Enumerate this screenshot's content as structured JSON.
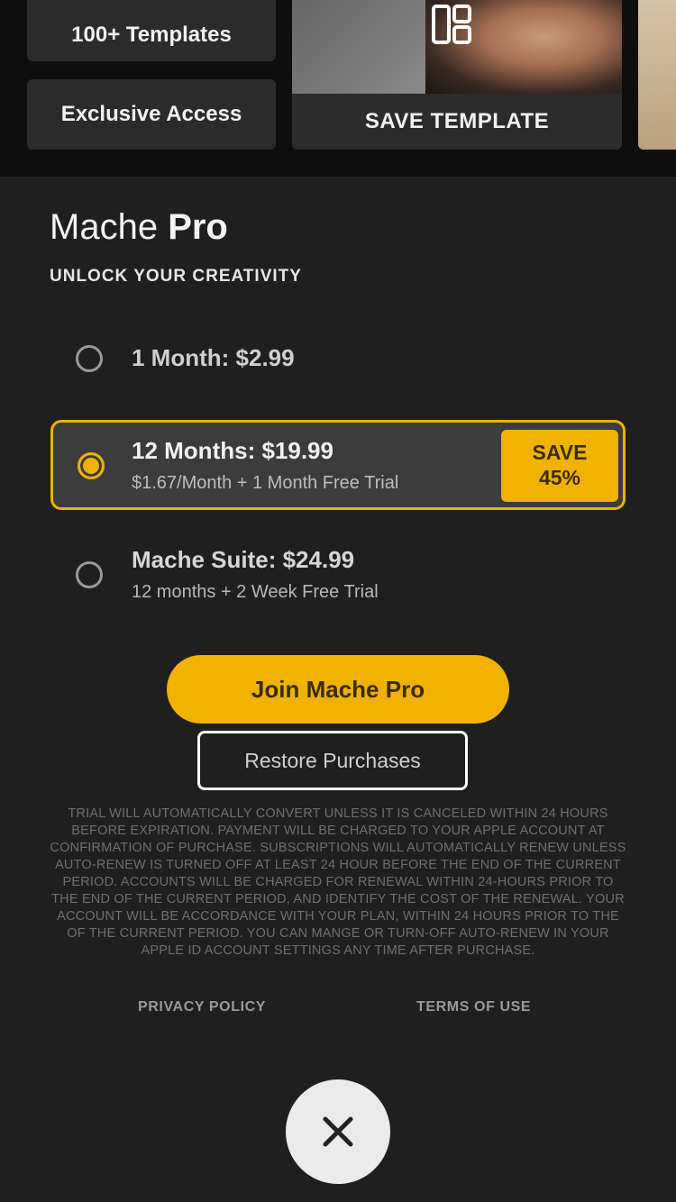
{
  "top_strip": {
    "feature_1": "100+ Templates",
    "feature_2": "Exclusive Access",
    "template_card_label": "SAVE TEMPLATE",
    "template_card_icon": "layout-icon"
  },
  "paywall": {
    "title_regular": "Mache",
    "title_bold": "Pro",
    "subtitle": "UNLOCK YOUR CREATIVITY",
    "plans": [
      {
        "name": "1 Month: $2.99",
        "detail": "",
        "selected": false
      },
      {
        "name": "12 Months: $19.99",
        "detail": "$1.67/Month + 1 Month Free Trial",
        "selected": true,
        "badge_line1": "SAVE",
        "badge_line2": "45%"
      },
      {
        "name": "Mache Suite: $24.99",
        "detail": "12 months + 2 Week Free Trial",
        "selected": false
      }
    ],
    "join_button": "Join Mache Pro",
    "restore_button": "Restore Purchases",
    "legal_text": "TRIAL WILL AUTOMATICALLY CONVERT UNLESS IT IS CANCELED WITHIN 24 HOURS BEFORE EXPIRATION. PAYMENT WILL BE CHARGED TO YOUR APPLE ACCOUNT AT CONFIRMATION OF PURCHASE. SUBSCRIPTIONS WILL AUTOMATICALLY RENEW UNLESS AUTO-RENEW IS TURNED OFF AT LEAST 24 HOUR BEFORE THE END OF THE CURRENT PERIOD. ACCOUNTS WILL BE CHARGED FOR RENEWAL WITHIN 24-HOURS PRIOR TO THE END OF THE CURRENT PERIOD, AND IDENTIFY THE COST OF THE RENEWAL. YOUR ACCOUNT WILL BE ACCORDANCE WITH YOUR PLAN, WITHIN 24 HOURS PRIOR TO THE OF THE CURRENT PERIOD. YOU CAN MANGE OR TURN-OFF AUTO-RENEW IN YOUR APPLE ID ACCOUNT SETTINGS ANY TIME AFTER PURCHASE.",
    "privacy_link": "PRIVACY POLICY",
    "terms_link": "TERMS OF USE",
    "close_icon": "close-icon"
  },
  "colors": {
    "accent": "#f0b100",
    "background": "#1f1f1f",
    "selected_plan_bg": "#3c3c3c"
  }
}
